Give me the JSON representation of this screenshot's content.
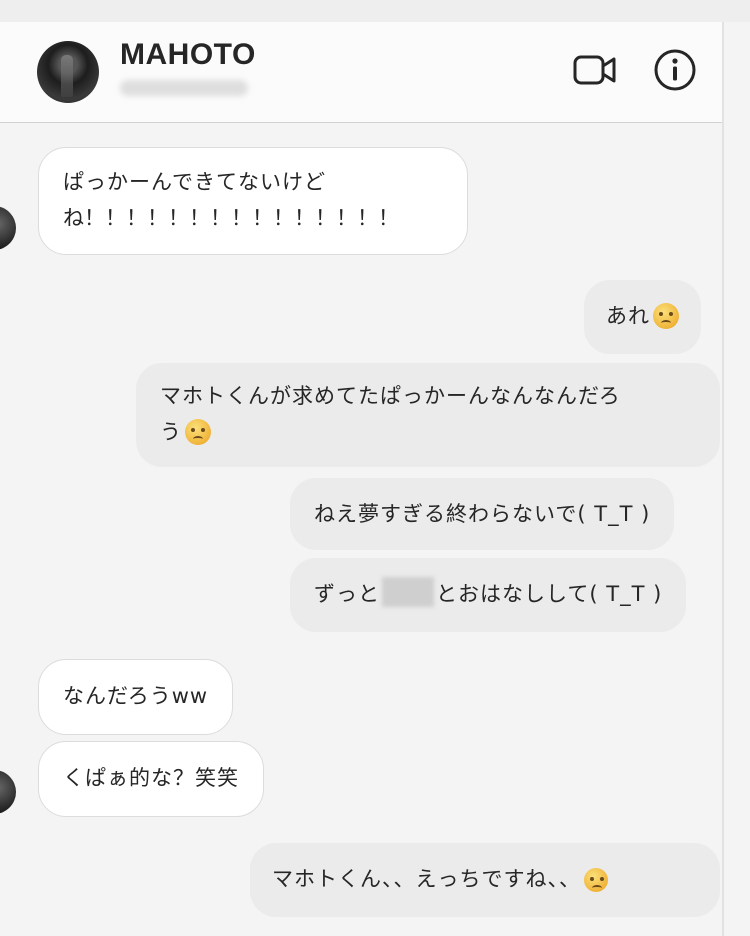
{
  "header": {
    "contact_name": "MAHOTO",
    "video_icon": "video-camera-icon",
    "info_icon": "info-icon"
  },
  "messages": [
    {
      "direction": "incoming",
      "lines": [
        "ぱっかーんできてないけど",
        "ね！！！！！！！！！！！！！！！"
      ]
    },
    {
      "direction": "outgoing",
      "text": "あれ",
      "emoji": "sad-face-emoji"
    },
    {
      "direction": "outgoing",
      "lines": [
        "マホトくんが求めてたぱっかーんなんなんだろ",
        "う"
      ],
      "emoji": "sad-face-emoji"
    },
    {
      "direction": "outgoing",
      "text": "ねえ夢すぎる終わらないで( T_T )"
    },
    {
      "direction": "outgoing",
      "before": "ずっと",
      "after": "とおはなしして( T_T )",
      "redacted": true
    },
    {
      "direction": "incoming",
      "text": "なんだろうww"
    },
    {
      "direction": "incoming",
      "text": "くぱぁ的な？笑笑"
    },
    {
      "direction": "outgoing",
      "text": "マホトくん、、えっちですね、、",
      "emoji": "pleading-face-emoji"
    }
  ]
}
